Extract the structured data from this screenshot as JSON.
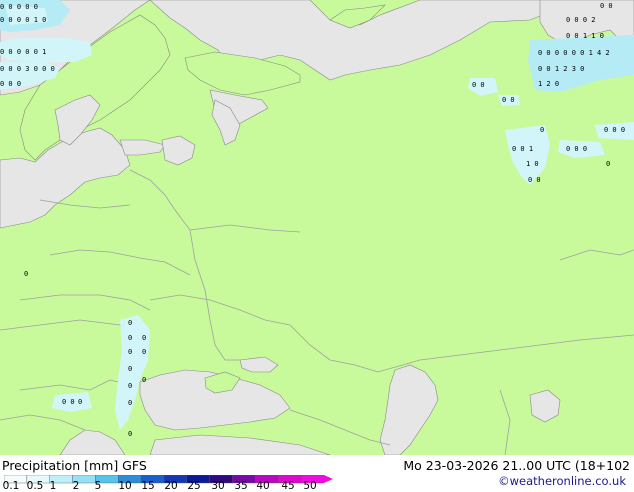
{
  "map": {
    "colors": {
      "land": "#c8fa9b",
      "sea": "#e6e6e6",
      "border": "#a0a0a0",
      "coast": "#888888",
      "precip_light": "#d2f5fa",
      "precip_mid": "#b4ebf5"
    },
    "precip_labels": [
      {
        "t": "0 0 0 0 0",
        "r": "n1"
      },
      {
        "t": "0 0 0 2",
        "r": "n2"
      },
      {
        "t": "0 0 1 1 0",
        "r": "n3"
      },
      {
        "t": "0 0",
        "r": "n4"
      },
      {
        "t": "0 0 0 0 0 0 1 4 2",
        "r": "n5"
      },
      {
        "t": "0 0 1 2 3 0",
        "r": "n6"
      },
      {
        "t": "1 2 0",
        "r": "n7"
      },
      {
        "t": "0 0",
        "r": "w1"
      },
      {
        "t": "0 0",
        "r": "w2"
      },
      {
        "t": "0",
        "r": "w3"
      },
      {
        "t": "0 0 0",
        "r": "w4"
      },
      {
        "t": "0 0 1",
        "r": "w5"
      },
      {
        "t": "0 0 0",
        "r": "w6"
      },
      {
        "t": "1 0",
        "r": "w7"
      },
      {
        "t": "0",
        "r": "w8"
      },
      {
        "t": "0 0",
        "r": "w9"
      },
      {
        "t": "0 0 0 0 1 0",
        "r": "s1"
      },
      {
        "t": "0 0 0 0 0 1",
        "r": "s2"
      },
      {
        "t": "0 0 0 3 0 0 0",
        "r": "s3"
      },
      {
        "t": "0 0 0",
        "r": "s4"
      },
      {
        "t": "0",
        "r": "s5"
      },
      {
        "t": "0",
        "r": "b1"
      },
      {
        "t": "0",
        "r": "b2"
      },
      {
        "t": "0",
        "r": "b3"
      },
      {
        "t": "0",
        "r": "b4"
      },
      {
        "t": "0",
        "r": "b5"
      },
      {
        "t": "0",
        "r": "b6"
      },
      {
        "t": "0",
        "r": "b7"
      },
      {
        "t": "0",
        "r": "b8"
      },
      {
        "t": "0",
        "r": "b9"
      },
      {
        "t": "0 0",
        "r": "t1"
      },
      {
        "t": "0",
        "r": "t2"
      },
      {
        "t": "0",
        "r": "t3"
      }
    ]
  },
  "footer": {
    "title_left": "Precipitation [mm] GFS",
    "title_right": "Mo 23-03-2026 21..00 UTC (18+102",
    "credit": "©weatheronline.co.uk"
  },
  "legend": {
    "colors": [
      "#f5fcfd",
      "#e6fafb",
      "#bfeff8",
      "#96e0f3",
      "#55c3ea",
      "#2a8fd8",
      "#1a5fcc",
      "#1438b4",
      "#0c1a96",
      "#300880",
      "#7a08a8",
      "#b808c0",
      "#e008d0",
      "#f00ce0"
    ],
    "ticks": [
      "0.1",
      "0.5",
      "1",
      "2",
      "5",
      "10",
      "15",
      "20",
      "25",
      "30",
      "35",
      "40",
      "45",
      "50"
    ]
  }
}
